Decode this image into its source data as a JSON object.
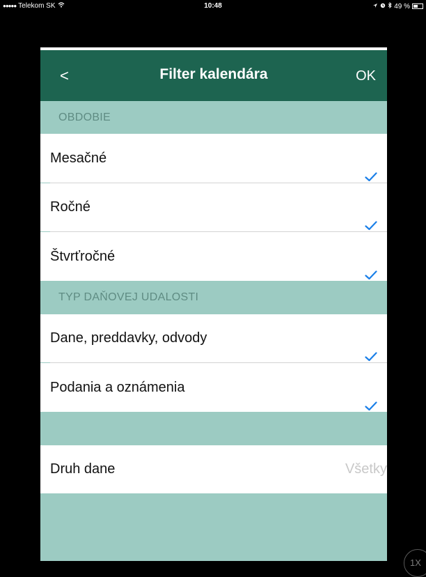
{
  "status_bar": {
    "signal": "●●●●●",
    "carrier": "Telekom SK",
    "wifi_icon": "wifi-icon",
    "time": "10:48",
    "location_icon": "location-arrow-icon",
    "alarm_icon": "alarm-icon",
    "bluetooth_icon": "bluetooth-icon",
    "battery_percent": "49 %",
    "battery_level": 0.49
  },
  "navbar": {
    "back_label": "<",
    "title": "Filter kalendára",
    "ok_label": "OK"
  },
  "sections": {
    "period": {
      "header": "OBDOBIE",
      "items": [
        {
          "label": "Mesačné",
          "checked": true
        },
        {
          "label": "Ročné",
          "checked": true
        },
        {
          "label": "Štvrťročné",
          "checked": true
        }
      ]
    },
    "event_type": {
      "header": "TYP DAŇOVEJ UDALOSTI",
      "items": [
        {
          "label": "Dane, preddavky, odvody",
          "checked": true
        },
        {
          "label": "Podania a oznámenia",
          "checked": true
        }
      ]
    },
    "tax_type": {
      "label": "Druh dane",
      "value": "Všetky"
    }
  },
  "zoom_badge": "1X",
  "colors": {
    "navbar": "#1d6450",
    "section_bg": "#9ccbc2",
    "section_text": "#5f8c83",
    "check": "#1a7fe8",
    "placeholder": "#c8c8c8"
  }
}
